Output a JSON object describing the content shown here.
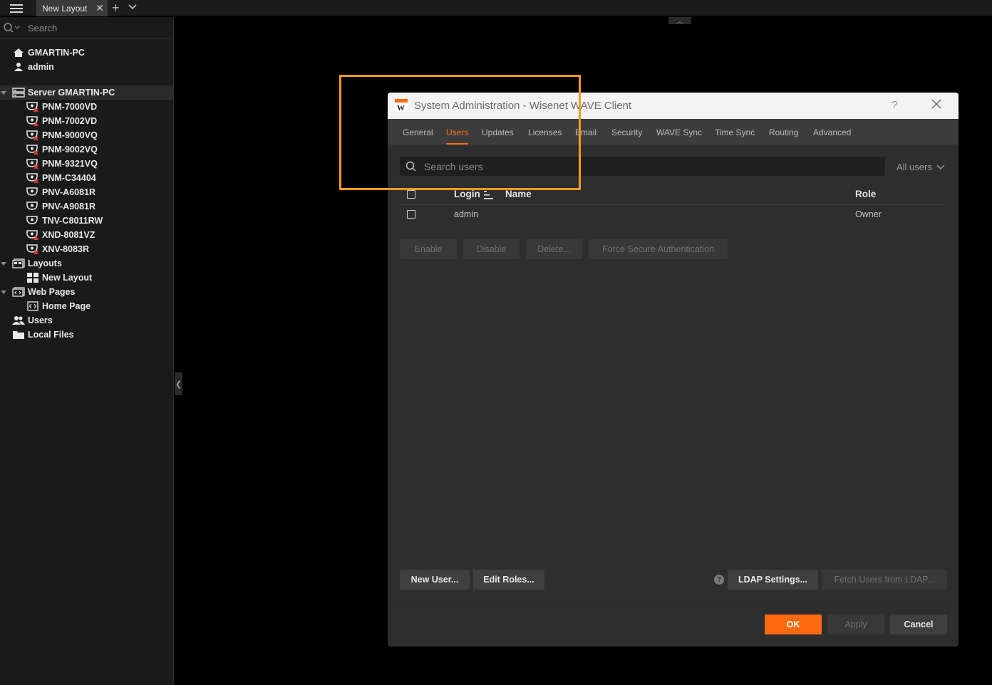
{
  "topbar": {
    "tab_label": "New Layout",
    "close_glyph": "✕",
    "add_glyph": "+"
  },
  "sidebar": {
    "search_placeholder": "Search",
    "host": "GMARTIN-PC",
    "user": "admin",
    "server": "Server GMARTIN-PC",
    "cameras": [
      {
        "name": "PNM-7000VD",
        "status": "error"
      },
      {
        "name": "PNM-7002VD",
        "status": "warning"
      },
      {
        "name": "PNM-9000VQ",
        "status": "error"
      },
      {
        "name": "PNM-9002VQ",
        "status": "error"
      },
      {
        "name": "PNM-9321VQ",
        "status": "error"
      },
      {
        "name": "PNM-C34404",
        "status": "error"
      },
      {
        "name": "PNV-A6081R",
        "status": "ok"
      },
      {
        "name": "PNV-A9081R",
        "status": "ok"
      },
      {
        "name": "TNV-C8011RW",
        "status": "ok"
      },
      {
        "name": "XND-8081VZ",
        "status": "warning"
      },
      {
        "name": "XNV-8083R",
        "status": "error"
      }
    ],
    "layouts": "Layouts",
    "new_layout": "New Layout",
    "web_pages": "Web Pages",
    "home_page": "Home Page",
    "users": "Users",
    "local_files": "Local Files"
  },
  "dialog": {
    "title": "System Administration - Wisenet WAVE Client",
    "help": "?",
    "tabs": [
      "General",
      "Users",
      "Updates",
      "Licenses",
      "Email",
      "Security",
      "WAVE Sync",
      "Time Sync",
      "Routing",
      "Advanced"
    ],
    "active_tab": "Users",
    "search_placeholder": "Search users",
    "filter": "All users",
    "columns": {
      "login": "Login",
      "name": "Name",
      "role": "Role"
    },
    "rows": [
      {
        "login": "admin",
        "name": "",
        "role": "Owner"
      }
    ],
    "actions": {
      "enable": "Enable",
      "disable": "Disable",
      "delete": "Delete...",
      "force": "Force Secure Authentication"
    },
    "new_user": "New User...",
    "edit_roles": "Edit Roles...",
    "ldap_help": "?",
    "ldap_settings": "LDAP Settings...",
    "fetch_ldap": "Fetch Users from LDAP...",
    "ok": "OK",
    "apply": "Apply",
    "cancel": "Cancel"
  },
  "colors": {
    "accent": "#ff6a10",
    "highlight": "#f39a1c",
    "error": "#e53935",
    "warning": "#e53935"
  }
}
